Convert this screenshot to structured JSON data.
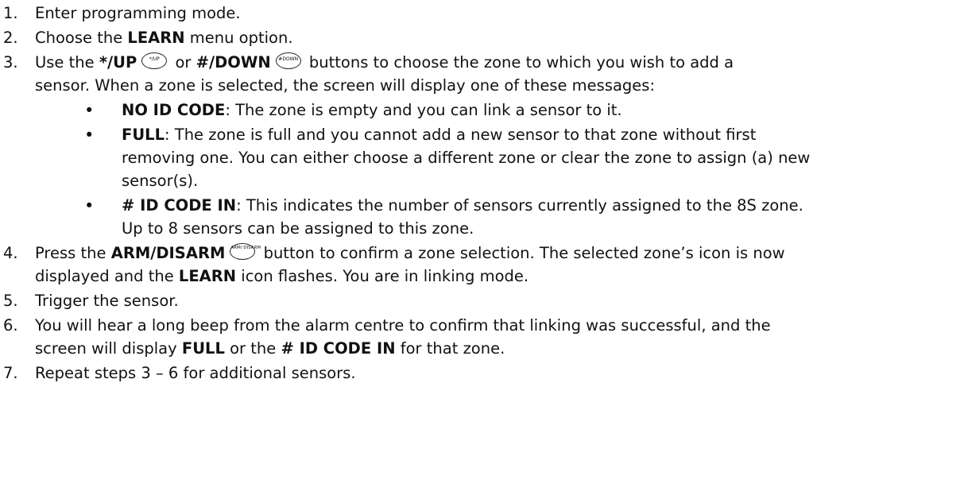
{
  "steps": [
    {
      "num": "1.",
      "text": "Enter programming mode."
    },
    {
      "num": "2.",
      "pre": "Choose the ",
      "bold": "LEARN",
      "post": " menu option."
    },
    {
      "num": "3.",
      "pre": "Use the ",
      "bold1": "*/UP",
      "key1": "*/UP",
      "mid": " or ",
      "bold2": "#/DOWN",
      "key2": "#DOWN",
      "post": " buttons to choose the zone to which you wish to add a",
      "cont": "sensor. When a zone is selected, the screen will display one of these messages:"
    },
    {
      "num": "4.",
      "pre": "Press the ",
      "bold": "ARM/DISARM",
      "key": "ARM/ DISARM",
      "post": " button to confirm a zone selection. The selected zone’s icon is now",
      "cont_bold": "LEARN",
      "cont_pre": "displayed and the ",
      "cont_post": " icon flashes. You are in linking mode."
    },
    {
      "num": "5.",
      "text": "Trigger the sensor."
    },
    {
      "num": "6.",
      "text": "You will hear a long beep from the alarm centre to confirm that linking was successful, and the",
      "cont_pre": "screen will display ",
      "cont_bold1": "FULL",
      "cont_mid": " or the ",
      "cont_bold2": "# ID CODE IN",
      "cont_post": " for that zone."
    },
    {
      "num": "7.",
      "text": "Repeat steps 3 – 6 for additional sensors."
    }
  ],
  "bullets": [
    {
      "symbol": "•",
      "bold": "NO ID CODE",
      "text": ":  The zone is empty and you can link a sensor to it."
    },
    {
      "symbol": "•",
      "bold": "FULL",
      "text": ": The zone is full and you cannot add a new sensor to that zone without first",
      "cont1": "removing one. You can either choose a different zone or clear the zone to assign (a) new",
      "cont2": "sensor(s)."
    },
    {
      "symbol": "•",
      "bold": "# ID CODE IN",
      "text": ": This indicates the number of sensors currently assigned to the 8S zone.",
      "cont1": "Up to 8 sensors can be assigned to this zone."
    }
  ]
}
